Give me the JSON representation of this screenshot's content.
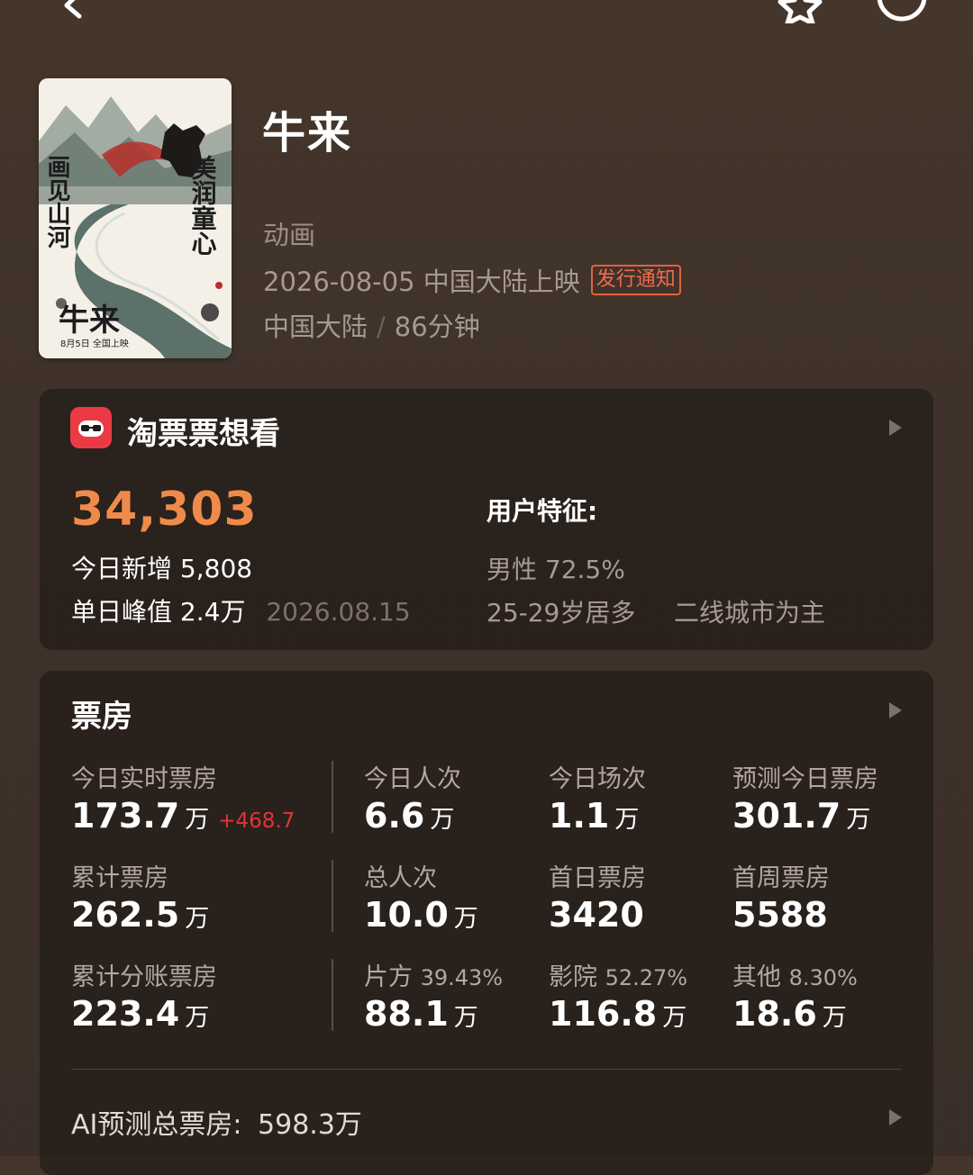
{
  "topbar": {
    "back_icon": "chevron-left-icon",
    "favorite_icon": "star-icon",
    "more_icon": "more-circle-icon"
  },
  "movie": {
    "title": "牛来",
    "genre": "动画",
    "release": "2026-08-05 中国大陆上映",
    "release_badge": "发行通知",
    "region": "中国大陆",
    "duration": "86分钟",
    "poster_text": {
      "left_vertical": "画见山河",
      "right_vertical": "美润童心",
      "title": "牛来",
      "date": "8月5日 全国上映"
    }
  },
  "want": {
    "title": "淘票票想看",
    "count": "34,303",
    "today_new_label": "今日新增",
    "today_new_value": "5,808",
    "peak_label": "单日峰值",
    "peak_value": "2.4万",
    "peak_date": "2026.08.15",
    "features_label": "用户特征:",
    "gender": "男性 72.5%",
    "age": "25-29岁居多",
    "city": "二线城市为主"
  },
  "boxoffice": {
    "title": "票房",
    "rows": [
      [
        {
          "label": "今日实时票房",
          "value": "173.7",
          "unit": "万",
          "delta": "+468.7"
        },
        {
          "label": "今日人次",
          "value": "6.6",
          "unit": "万"
        },
        {
          "label": "今日场次",
          "value": "1.1",
          "unit": "万"
        },
        {
          "label": "预测今日票房",
          "value": "301.7",
          "unit": "万"
        }
      ],
      [
        {
          "label": "累计票房",
          "value": "262.5",
          "unit": "万"
        },
        {
          "label": "总人次",
          "value": "10.0",
          "unit": "万"
        },
        {
          "label": "首日票房",
          "value": "3420",
          "unit": ""
        },
        {
          "label": "首周票房",
          "value": "5588",
          "unit": ""
        }
      ],
      [
        {
          "label": "累计分账票房",
          "value": "223.4",
          "unit": "万"
        },
        {
          "label": "片方",
          "pct": "39.43%",
          "value": "88.1",
          "unit": "万"
        },
        {
          "label": "影院",
          "pct": "52.27%",
          "value": "116.8",
          "unit": "万"
        },
        {
          "label": "其他",
          "pct": "8.30%",
          "value": "18.6",
          "unit": "万"
        }
      ]
    ],
    "ai_label": "AI预测总票房:",
    "ai_value": "598.3万"
  },
  "colors": {
    "accent_orange": "#f08a4a",
    "delta_red": "#e3333b",
    "badge_red": "#e5603f",
    "logo_red": "#ec3a44"
  }
}
